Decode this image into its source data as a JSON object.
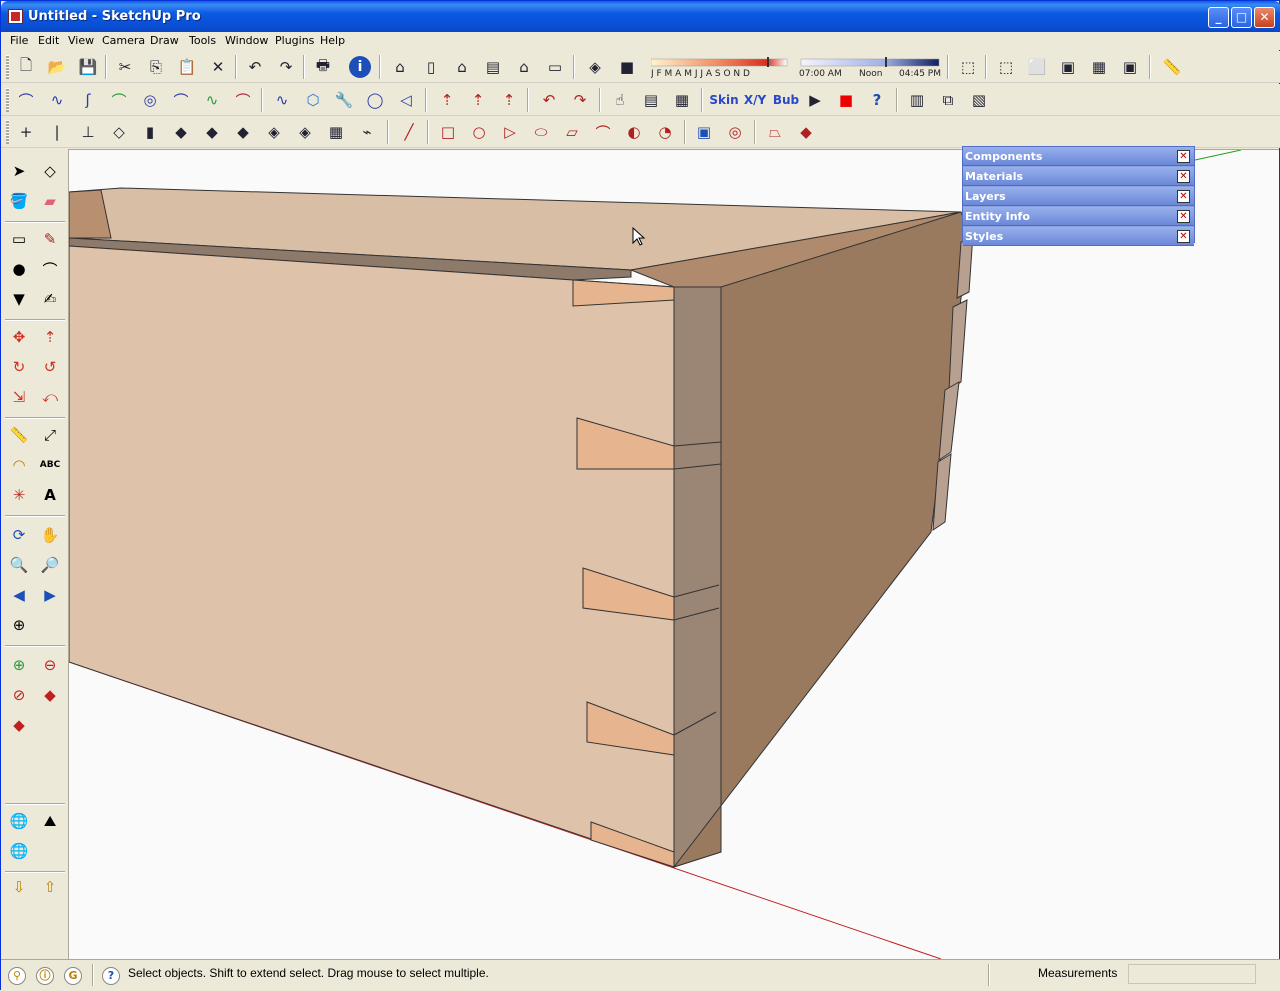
{
  "window": {
    "title": "Untitled - SketchUp Pro"
  },
  "menu": [
    "File",
    "Edit",
    "View",
    "Camera",
    "Draw",
    "Tools",
    "Window",
    "Plugins",
    "Help"
  ],
  "shadow_settings": {
    "months": "J F M A M J J A S O N D",
    "time_start": "07:00 AM",
    "time_noon": "Noon",
    "time_end": "04:45 PM"
  },
  "plugin_buttons": {
    "skin": "Skin",
    "xyz": "X/Y",
    "bub": "Bub"
  },
  "trays": [
    {
      "label": "Components"
    },
    {
      "label": "Materials"
    },
    {
      "label": "Layers"
    },
    {
      "label": "Entity Info"
    },
    {
      "label": "Styles"
    }
  ],
  "status": {
    "hint": "Select objects. Shift to extend select. Drag mouse to select multiple.",
    "measurements_label": "Measurements",
    "measurements_value": ""
  },
  "colors": {
    "title_bar": "#0a5fe0",
    "wood_light": "#dfc2aa",
    "wood_dark": "#9a7a5e",
    "tray_blue": "#6a88d8"
  }
}
